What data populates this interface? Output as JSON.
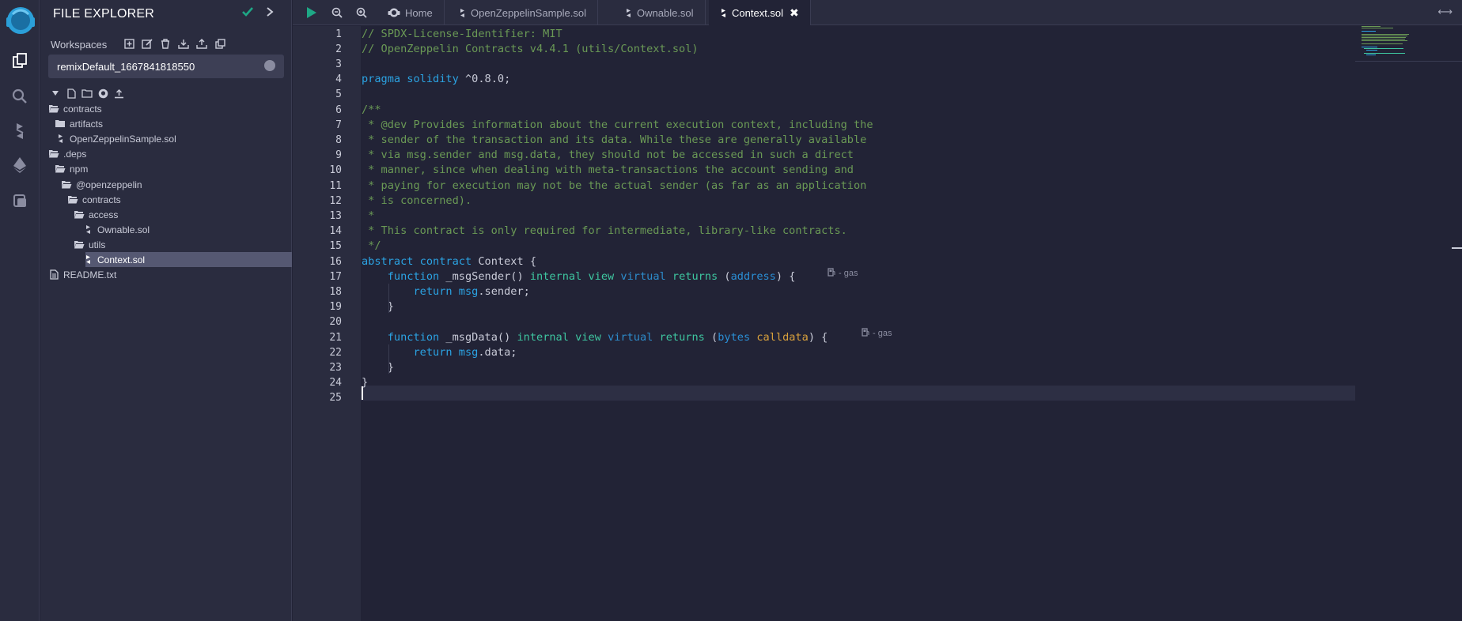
{
  "panel": {
    "title": "FILE EXPLORER",
    "workspaces_label": "Workspaces",
    "workspace_selected": "remixDefault_1667841818550"
  },
  "tree": [
    {
      "label": "contracts",
      "type": "folder-open",
      "depth": 0
    },
    {
      "label": "artifacts",
      "type": "folder",
      "depth": 1
    },
    {
      "label": "OpenZeppelinSample.sol",
      "type": "sol",
      "depth": 1
    },
    {
      "label": ".deps",
      "type": "folder-open",
      "depth": 0
    },
    {
      "label": "npm",
      "type": "folder-open",
      "depth": 1
    },
    {
      "label": "@openzeppelin",
      "type": "folder-open",
      "depth": 2
    },
    {
      "label": "contracts",
      "type": "folder-open",
      "depth": 3
    },
    {
      "label": "access",
      "type": "folder-open",
      "depth": 4
    },
    {
      "label": "Ownable.sol",
      "type": "sol",
      "depth": 5
    },
    {
      "label": "utils",
      "type": "folder-open",
      "depth": 4
    },
    {
      "label": "Context.sol",
      "type": "sol",
      "depth": 5,
      "selected": true
    },
    {
      "label": "README.txt",
      "type": "file",
      "depth": 0
    }
  ],
  "tabs": [
    {
      "label": "Home",
      "icon": "home-icon"
    },
    {
      "label": "OpenZeppelinSample.sol",
      "icon": "solidity-icon"
    },
    {
      "label": "Ownable.sol",
      "icon": "solidity-icon"
    },
    {
      "label": "Context.sol",
      "icon": "solidity-icon",
      "active": true,
      "close": "✖"
    }
  ],
  "gas_label": "- gas",
  "code": [
    "// SPDX-License-Identifier: MIT",
    "// OpenZeppelin Contracts v4.4.1 (utils/Context.sol)",
    "",
    "pragma solidity ^0.8.0;",
    "",
    "/**",
    " * @dev Provides information about the current execution context, including the",
    " * sender of the transaction and its data. While these are generally available",
    " * via msg.sender and msg.data, they should not be accessed in such a direct",
    " * manner, since when dealing with meta-transactions the account sending and",
    " * paying for execution may not be the actual sender (as far as an application",
    " * is concerned).",
    " *",
    " * This contract is only required for intermediate, library-like contracts.",
    " */",
    "abstract contract Context {",
    "    function _msgSender() internal view virtual returns (address) {",
    "        return msg.sender;",
    "    }",
    "",
    "    function _msgData() internal view virtual returns (bytes calldata) {",
    "        return msg.data;",
    "    }",
    "}",
    ""
  ],
  "colors": {
    "background": "#222336",
    "panel": "#2a2c3f",
    "comment": "#6a9955",
    "keyword": "#2ba3e3",
    "keyword_alt": "#3ec6a0",
    "run": "#1ea886"
  }
}
